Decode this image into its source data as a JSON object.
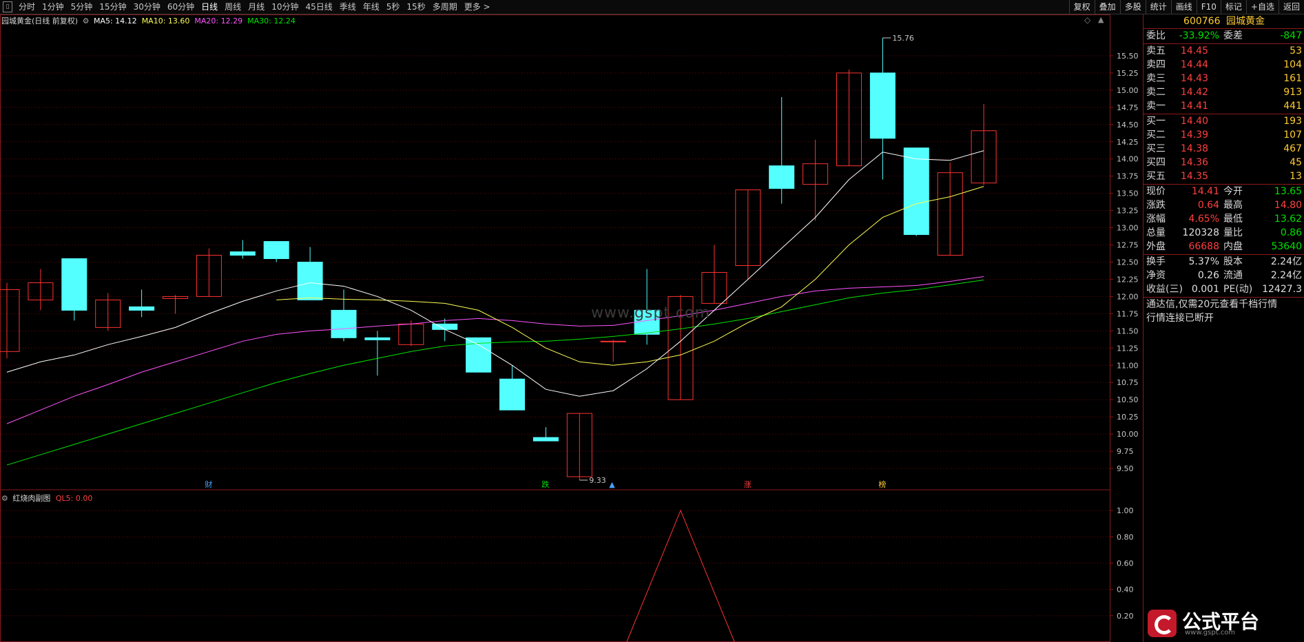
{
  "toolbar": {
    "tabs": [
      "分时",
      "1分钟",
      "5分钟",
      "15分钟",
      "30分钟",
      "60分钟",
      "日线",
      "周线",
      "月线",
      "10分钟",
      "45日线",
      "季线",
      "年线",
      "5秒",
      "15秒",
      "多周期",
      "更多 >"
    ],
    "active_tab": "日线",
    "right_buttons": [
      "复权",
      "叠加",
      "多股",
      "统计",
      "画线",
      "F10",
      "标记",
      "+自选",
      "返回"
    ]
  },
  "chart_header": {
    "stock_title": "园城黄金(日线 前复权)",
    "ma5": "MA5: 14.12",
    "ma10": "MA10: 13.60",
    "ma20": "MA20: 12.29",
    "ma30": "MA30: 12.24"
  },
  "sub_header": {
    "title": "红烧肉副图",
    "ql5": "QL5: 0.00"
  },
  "colors": {
    "up": "#ff3232",
    "down": "#54ffff",
    "ma5": "#ffffff",
    "ma10": "#ffff55",
    "ma20": "#ff55ff",
    "ma30": "#00e600",
    "grid": "#6a0a0a",
    "border": "#8b1a1a"
  },
  "watermark": "www.gspt.com",
  "logo_text": "公式平台",
  "logo_url": "www.gspt.com",
  "events": [
    {
      "label": "财",
      "index": 6,
      "color": "#4aa3ff"
    },
    {
      "label": "跌",
      "index": 16,
      "color": "#00e000"
    },
    {
      "label": "▲",
      "index": 18,
      "color": "#4aa3ff"
    },
    {
      "label": "涨",
      "index": 22,
      "color": "#ff4040"
    },
    {
      "label": "榜",
      "index": 26,
      "color": "#ffcc33"
    }
  ],
  "chart_data": [
    {
      "type": "candlestick",
      "title": "园城黄金(日线 前复权)",
      "y_ticks": [
        9.5,
        9.75,
        10.0,
        10.25,
        10.5,
        10.75,
        11.0,
        11.25,
        11.5,
        11.75,
        12.0,
        12.25,
        12.5,
        12.75,
        13.0,
        13.25,
        13.5,
        13.75,
        14.0,
        14.25,
        14.5,
        14.75,
        15.0,
        15.25,
        15.5
      ],
      "ylim": [
        9.2,
        15.9
      ],
      "high_label": "15.76",
      "low_label": "9.33",
      "candles": [
        {
          "o": 11.2,
          "h": 12.2,
          "l": 11.1,
          "c": 12.1
        },
        {
          "o": 11.95,
          "h": 12.4,
          "l": 11.8,
          "c": 12.2
        },
        {
          "o": 12.55,
          "h": 12.55,
          "l": 11.65,
          "c": 11.8
        },
        {
          "o": 11.55,
          "h": 12.05,
          "l": 11.5,
          "c": 11.95
        },
        {
          "o": 11.85,
          "h": 12.1,
          "l": 11.7,
          "c": 11.8
        },
        {
          "o": 11.97,
          "h": 12.02,
          "l": 11.75,
          "c": 12.0
        },
        {
          "o": 12.0,
          "h": 12.7,
          "l": 12.0,
          "c": 12.6
        },
        {
          "o": 12.65,
          "h": 12.82,
          "l": 12.55,
          "c": 12.6
        },
        {
          "o": 12.8,
          "h": 12.75,
          "l": 12.5,
          "c": 12.55
        },
        {
          "o": 12.5,
          "h": 12.72,
          "l": 11.95,
          "c": 11.95
        },
        {
          "o": 11.8,
          "h": 12.1,
          "l": 11.35,
          "c": 11.4
        },
        {
          "o": 11.4,
          "h": 11.5,
          "l": 10.85,
          "c": 11.37
        },
        {
          "o": 11.3,
          "h": 11.65,
          "l": 11.28,
          "c": 11.6
        },
        {
          "o": 11.6,
          "h": 11.68,
          "l": 11.35,
          "c": 11.52
        },
        {
          "o": 11.4,
          "h": 11.4,
          "l": 10.9,
          "c": 10.9
        },
        {
          "o": 10.8,
          "h": 11.0,
          "l": 10.35,
          "c": 10.35
        },
        {
          "o": 9.95,
          "h": 10.1,
          "l": 9.9,
          "c": 9.9
        },
        {
          "o": 9.38,
          "h": 10.3,
          "l": 9.33,
          "c": 10.3
        },
        {
          "o": 11.35,
          "h": 11.37,
          "l": 11.05,
          "c": 11.35
        },
        {
          "o": 11.8,
          "h": 12.4,
          "l": 11.3,
          "c": 11.45
        },
        {
          "o": 10.5,
          "h": 12.02,
          "l": 10.5,
          "c": 12.0
        },
        {
          "o": 11.9,
          "h": 12.75,
          "l": 11.9,
          "c": 12.35
        },
        {
          "o": 12.45,
          "h": 13.55,
          "l": 12.25,
          "c": 13.55
        },
        {
          "o": 13.9,
          "h": 14.9,
          "l": 13.35,
          "c": 13.57
        },
        {
          "o": 13.63,
          "h": 14.28,
          "l": 13.1,
          "c": 13.93
        },
        {
          "o": 13.9,
          "h": 15.3,
          "l": 13.9,
          "c": 15.25
        },
        {
          "o": 15.25,
          "h": 15.76,
          "l": 13.7,
          "c": 14.3
        },
        {
          "o": 14.16,
          "h": 14.16,
          "l": 12.88,
          "c": 12.9
        },
        {
          "o": 12.6,
          "h": 13.95,
          "l": 12.6,
          "c": 13.8
        },
        {
          "o": 13.65,
          "h": 14.8,
          "l": 13.62,
          "c": 14.41
        }
      ],
      "ma5": [
        [
          0,
          10.9
        ],
        [
          1,
          11.05
        ],
        [
          2,
          11.15
        ],
        [
          3,
          11.3
        ],
        [
          4,
          11.42
        ],
        [
          5,
          11.55
        ],
        [
          6,
          11.75
        ],
        [
          7,
          11.93
        ],
        [
          8,
          12.08
        ],
        [
          9,
          12.2
        ],
        [
          10,
          12.15
        ],
        [
          11,
          12.0
        ],
        [
          12,
          11.8
        ],
        [
          13,
          11.52
        ],
        [
          14,
          11.3
        ],
        [
          15,
          11.0
        ],
        [
          16,
          10.65
        ],
        [
          17,
          10.55
        ],
        [
          18,
          10.63
        ],
        [
          19,
          10.95
        ],
        [
          20,
          11.35
        ],
        [
          21,
          11.8
        ],
        [
          22,
          12.25
        ],
        [
          23,
          12.7
        ],
        [
          24,
          13.15
        ],
        [
          25,
          13.7
        ],
        [
          26,
          14.1
        ],
        [
          27,
          14.0
        ],
        [
          28,
          13.98
        ],
        [
          29,
          14.12
        ]
      ],
      "ma10": [
        [
          8,
          11.95
        ],
        [
          9,
          11.98
        ],
        [
          10,
          11.96
        ],
        [
          11,
          11.95
        ],
        [
          12,
          11.93
        ],
        [
          13,
          11.9
        ],
        [
          14,
          11.8
        ],
        [
          15,
          11.55
        ],
        [
          16,
          11.25
        ],
        [
          17,
          11.05
        ],
        [
          18,
          11.0
        ],
        [
          19,
          11.05
        ],
        [
          20,
          11.15
        ],
        [
          21,
          11.35
        ],
        [
          22,
          11.62
        ],
        [
          23,
          11.85
        ],
        [
          24,
          12.25
        ],
        [
          25,
          12.75
        ],
        [
          26,
          13.15
        ],
        [
          27,
          13.35
        ],
        [
          28,
          13.45
        ],
        [
          29,
          13.6
        ]
      ],
      "ma20": [
        [
          0,
          10.15
        ],
        [
          1,
          10.35
        ],
        [
          2,
          10.55
        ],
        [
          3,
          10.72
        ],
        [
          4,
          10.9
        ],
        [
          5,
          11.05
        ],
        [
          6,
          11.2
        ],
        [
          7,
          11.35
        ],
        [
          8,
          11.45
        ],
        [
          9,
          11.5
        ],
        [
          10,
          11.53
        ],
        [
          11,
          11.57
        ],
        [
          12,
          11.6
        ],
        [
          13,
          11.65
        ],
        [
          14,
          11.68
        ],
        [
          15,
          11.65
        ],
        [
          16,
          11.6
        ],
        [
          17,
          11.57
        ],
        [
          18,
          11.58
        ],
        [
          19,
          11.65
        ],
        [
          20,
          11.72
        ],
        [
          21,
          11.8
        ],
        [
          22,
          11.9
        ],
        [
          23,
          12.0
        ],
        [
          24,
          12.08
        ],
        [
          25,
          12.12
        ],
        [
          26,
          12.14
        ],
        [
          27,
          12.16
        ],
        [
          28,
          12.22
        ],
        [
          29,
          12.29
        ]
      ],
      "ma30": [
        [
          0,
          9.55
        ],
        [
          1,
          9.7
        ],
        [
          2,
          9.85
        ],
        [
          3,
          10.0
        ],
        [
          4,
          10.15
        ],
        [
          5,
          10.3
        ],
        [
          6,
          10.45
        ],
        [
          7,
          10.6
        ],
        [
          8,
          10.75
        ],
        [
          9,
          10.88
        ],
        [
          10,
          11.0
        ],
        [
          11,
          11.1
        ],
        [
          12,
          11.2
        ],
        [
          13,
          11.28
        ],
        [
          14,
          11.32
        ],
        [
          15,
          11.34
        ],
        [
          16,
          11.35
        ],
        [
          17,
          11.38
        ],
        [
          18,
          11.42
        ],
        [
          19,
          11.47
        ],
        [
          20,
          11.53
        ],
        [
          21,
          11.6
        ],
        [
          22,
          11.68
        ],
        [
          23,
          11.78
        ],
        [
          24,
          11.88
        ],
        [
          25,
          11.98
        ],
        [
          26,
          12.05
        ],
        [
          27,
          12.1
        ],
        [
          28,
          12.17
        ],
        [
          29,
          12.24
        ]
      ]
    },
    {
      "type": "line",
      "title": "红烧肉副图",
      "series": [
        {
          "name": "QL5",
          "values": [
            [
              18.4,
              0
            ],
            [
              20,
              1
            ],
            [
              21.6,
              0
            ]
          ]
        }
      ],
      "y_ticks": [
        0.2,
        0.4,
        0.6,
        0.8,
        1.0
      ],
      "ylim": [
        0,
        1.1
      ]
    }
  ],
  "quote": {
    "code": "600766",
    "name": "园城黄金",
    "weibi_label": "委比",
    "weibi_value": "-33.92%",
    "weicha_label": "委差",
    "weicha_value": "-847",
    "asks": [
      {
        "label": "卖五",
        "price": "14.45",
        "vol": "53"
      },
      {
        "label": "卖四",
        "price": "14.44",
        "vol": "104"
      },
      {
        "label": "卖三",
        "price": "14.43",
        "vol": "161"
      },
      {
        "label": "卖二",
        "price": "14.42",
        "vol": "913"
      },
      {
        "label": "卖一",
        "price": "14.41",
        "vol": "441"
      }
    ],
    "bids": [
      {
        "label": "买一",
        "price": "14.40",
        "vol": "193"
      },
      {
        "label": "买二",
        "price": "14.39",
        "vol": "107"
      },
      {
        "label": "买三",
        "price": "14.38",
        "vol": "467"
      },
      {
        "label": "买四",
        "price": "14.36",
        "vol": "45"
      },
      {
        "label": "买五",
        "price": "14.35",
        "vol": "13"
      }
    ],
    "stats": [
      {
        "l1": "现价",
        "v1": "14.41",
        "c1": "red",
        "l2": "今开",
        "v2": "13.65",
        "c2": "green"
      },
      {
        "l1": "涨跌",
        "v1": "0.64",
        "c1": "red",
        "l2": "最高",
        "v2": "14.80",
        "c2": "red"
      },
      {
        "l1": "涨幅",
        "v1": "4.65%",
        "c1": "red",
        "l2": "最低",
        "v2": "13.62",
        "c2": "green"
      },
      {
        "l1": "总量",
        "v1": "120328",
        "c1": "white",
        "l2": "量比",
        "v2": "0.86",
        "c2": "green"
      },
      {
        "l1": "外盘",
        "v1": "66688",
        "c1": "red",
        "l2": "内盘",
        "v2": "53640",
        "c2": "green"
      }
    ],
    "fin": [
      {
        "l1": "换手",
        "v1": "5.37%",
        "l2": "股本",
        "v2": "2.24亿"
      },
      {
        "l1": "净资",
        "v1": "0.26",
        "l2": "流通",
        "v2": "2.24亿"
      },
      {
        "l1": "收益(三)",
        "v1": "0.001",
        "l2": "PE(动)",
        "v2": "12427.3"
      }
    ],
    "notice1": "通达信,仅需20元查看千档行情",
    "notice2": "行情连接已断开"
  }
}
